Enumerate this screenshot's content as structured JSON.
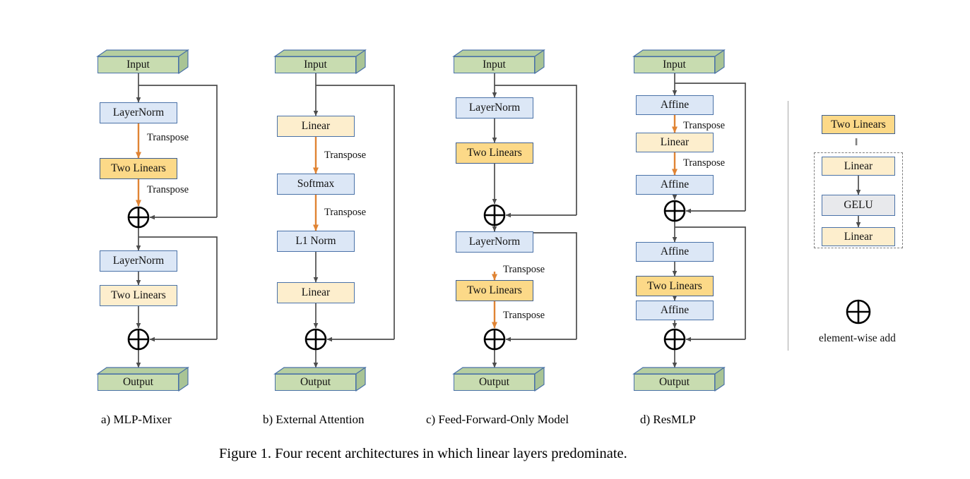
{
  "figure": {
    "caption": "Figure 1. Four recent architectures in which linear layers predominate.",
    "column_captions": [
      "a) MLP-Mixer",
      "b) External Attention",
      "c) Feed-Forward-Only Model",
      "d) ResMLP"
    ]
  },
  "colors": {
    "input_output_fill": "#c8dcb0",
    "norm_fill": "#dce7f6",
    "two_linears_fill": "#fcd988",
    "linear_fill": "#fdeecd",
    "gelu_fill": "#e8e9ec",
    "box_border": "#4a72a8",
    "transpose_arrow": "#e08434",
    "plain_arrow": "#4d4d4d",
    "divider": "#a8a8a8",
    "dashed_border": "#7d7d7d"
  },
  "columns": [
    {
      "id": "mlp-mixer",
      "caption": "a) MLP-Mixer",
      "nodes": [
        {
          "name": "input",
          "label": "Input",
          "kind": "cuboid"
        },
        {
          "name": "layernorm-1",
          "label": "LayerNorm",
          "kind": "blue"
        },
        {
          "name": "two-linears-1",
          "label": "Two Linears",
          "kind": "gold"
        },
        {
          "name": "add-1",
          "label": "element-wise add",
          "kind": "plus"
        },
        {
          "name": "layernorm-2",
          "label": "LayerNorm",
          "kind": "blue"
        },
        {
          "name": "two-linears-2",
          "label": "Two Linears",
          "kind": "cream"
        },
        {
          "name": "add-2",
          "label": "element-wise add",
          "kind": "plus"
        },
        {
          "name": "output",
          "label": "Output",
          "kind": "cuboid"
        }
      ],
      "edge_labels": [
        "Transpose",
        "Transpose"
      ]
    },
    {
      "id": "external-attention",
      "caption": "b) External Attention",
      "nodes": [
        {
          "name": "input",
          "label": "Input",
          "kind": "cuboid"
        },
        {
          "name": "linear-1",
          "label": "Linear",
          "kind": "cream"
        },
        {
          "name": "softmax",
          "label": "Softmax",
          "kind": "blue"
        },
        {
          "name": "l1-norm",
          "label": "L1 Norm",
          "kind": "blue"
        },
        {
          "name": "linear-2",
          "label": "Linear",
          "kind": "cream"
        },
        {
          "name": "add-1",
          "label": "element-wise add",
          "kind": "plus"
        },
        {
          "name": "output",
          "label": "Output",
          "kind": "cuboid"
        }
      ],
      "edge_labels": [
        "Transpose",
        "Transpose"
      ]
    },
    {
      "id": "feed-forward-only-model",
      "caption": "c) Feed-Forward-Only Model",
      "nodes": [
        {
          "name": "input",
          "label": "Input",
          "kind": "cuboid"
        },
        {
          "name": "layernorm-1",
          "label": "LayerNorm",
          "kind": "blue"
        },
        {
          "name": "two-linears-1",
          "label": "Two Linears",
          "kind": "gold"
        },
        {
          "name": "add-1",
          "label": "element-wise add",
          "kind": "plus"
        },
        {
          "name": "layernorm-2",
          "label": "LayerNorm",
          "kind": "blue"
        },
        {
          "name": "two-linears-2",
          "label": "Two Linears",
          "kind": "gold"
        },
        {
          "name": "add-2",
          "label": "element-wise add",
          "kind": "plus"
        },
        {
          "name": "output",
          "label": "Output",
          "kind": "cuboid"
        }
      ],
      "edge_labels": [
        "Transpose",
        "Transpose"
      ]
    },
    {
      "id": "resmlp",
      "caption": "d) ResMLP",
      "nodes": [
        {
          "name": "input",
          "label": "Input",
          "kind": "cuboid"
        },
        {
          "name": "affine-1",
          "label": "Affine",
          "kind": "blue"
        },
        {
          "name": "linear-1",
          "label": "Linear",
          "kind": "cream"
        },
        {
          "name": "affine-2",
          "label": "Affine",
          "kind": "blue"
        },
        {
          "name": "add-1",
          "label": "element-wise add",
          "kind": "plus"
        },
        {
          "name": "affine-3",
          "label": "Affine",
          "kind": "blue"
        },
        {
          "name": "two-linears",
          "label": "Two Linears",
          "kind": "gold"
        },
        {
          "name": "affine-4",
          "label": "Affine",
          "kind": "blue"
        },
        {
          "name": "add-2",
          "label": "element-wise add",
          "kind": "plus"
        },
        {
          "name": "output",
          "label": "Output",
          "kind": "cuboid"
        }
      ],
      "edge_labels": [
        "Transpose",
        "Transpose"
      ]
    }
  ],
  "legend": {
    "two_linears_label": "Two Linears",
    "equals_symbol": "‖",
    "expansion": [
      "Linear",
      "GELU",
      "Linear"
    ],
    "add_symbol": "⊕",
    "add_caption": "element-wise add"
  },
  "edge_text": {
    "transpose": "Transpose"
  }
}
